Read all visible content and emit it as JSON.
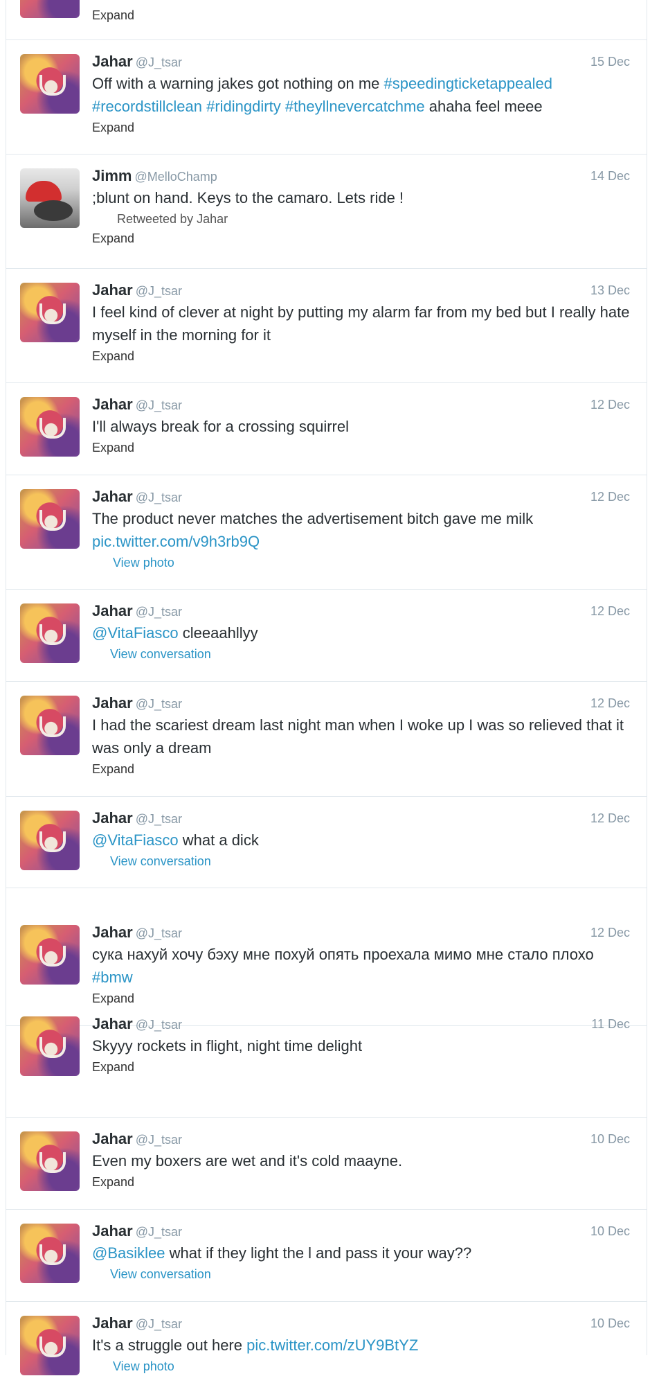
{
  "timeline": {
    "top_fragment": {
      "expand_label": "Expand"
    },
    "tweets": [
      {
        "name": "Jahar",
        "handle": "@J_tsar",
        "date": "15 Dec",
        "text_parts": [
          {
            "t": "Off with a warning jakes got nothing on me "
          },
          {
            "t": "#speedingticketappealed",
            "link": true
          },
          {
            "t": " "
          },
          {
            "t": "#recordstillclean",
            "link": true
          },
          {
            "t": " "
          },
          {
            "t": "#ridingdirty",
            "link": true
          },
          {
            "t": " "
          },
          {
            "t": "#theyllnevercatchme",
            "link": true
          },
          {
            "t": " ahaha feel meee"
          }
        ],
        "action": "Expand"
      },
      {
        "name": "Jimm",
        "handle": "@MelloChamp",
        "date": "14 Dec",
        "text_parts": [
          {
            "t": ";blunt on hand. Keys to the camaro. Lets ride !"
          }
        ],
        "retweeted_by": "Retweeted by Jahar",
        "action": "Expand"
      },
      {
        "name": "Jahar",
        "handle": "@J_tsar",
        "date": "13 Dec",
        "text_parts": [
          {
            "t": "I feel kind of clever at night by putting my alarm far from my bed but I really hate myself in the morning for it"
          }
        ],
        "action": "Expand"
      },
      {
        "name": "Jahar",
        "handle": "@J_tsar",
        "date": "12 Dec",
        "text_parts": [
          {
            "t": "I'll always break for a crossing squirrel"
          }
        ],
        "action": "Expand"
      },
      {
        "name": "Jahar",
        "handle": "@J_tsar",
        "date": "12 Dec",
        "text_parts": [
          {
            "t": "The product never matches the advertisement bitch gave me milk "
          },
          {
            "t": "pic.twitter.com/v9h3rb9Q",
            "link": true
          }
        ],
        "action": "View photo"
      },
      {
        "name": "Jahar",
        "handle": "@J_tsar",
        "date": "12 Dec",
        "text_parts": [
          {
            "t": "@VitaFiasco",
            "link": true
          },
          {
            "t": " cleeaahllyy"
          }
        ],
        "action": "View conversation"
      },
      {
        "name": "Jahar",
        "handle": "@J_tsar",
        "date": "12 Dec",
        "text_parts": [
          {
            "t": "I had the scariest dream last night man when I woke up I was so relieved that it was only a dream"
          }
        ],
        "action": "Expand"
      },
      {
        "name": "Jahar",
        "handle": "@J_tsar",
        "date": "12 Dec",
        "text_parts": [
          {
            "t": "@VitaFiasco",
            "link": true
          },
          {
            "t": " what a dick"
          }
        ],
        "action": "View conversation"
      },
      {
        "name": "Jahar",
        "handle": "@J_tsar",
        "date": "12 Dec",
        "text_parts": [
          {
            "t": "сука нахуй хочу бэху мне похуй опять проехала мимо мне стало плохо "
          },
          {
            "t": "#bmw",
            "link": true
          }
        ],
        "action": "Expand"
      },
      {
        "name": "Jahar",
        "handle": "@J_tsar",
        "date": "11 Dec",
        "text_parts": [
          {
            "t": "Skyyy rockets in flight, night time delight"
          }
        ],
        "action": "Expand"
      },
      {
        "name": "Jahar",
        "handle": "@J_tsar",
        "date": "10 Dec",
        "text_parts": [
          {
            "t": "Even my boxers are wet and it's cold maayne."
          }
        ],
        "action": "Expand"
      },
      {
        "name": "Jahar",
        "handle": "@J_tsar",
        "date": "10 Dec",
        "text_parts": [
          {
            "t": "@Basiklee",
            "link": true
          },
          {
            "t": " what if they light the l and pass it your way??"
          }
        ],
        "action": "View conversation"
      },
      {
        "name": "Jahar",
        "handle": "@J_tsar",
        "date": "10 Dec",
        "text_parts": [
          {
            "t": "It's a struggle out here "
          },
          {
            "t": "pic.twitter.com/zUY9BtYZ",
            "link": true
          }
        ],
        "action": "View photo"
      }
    ]
  },
  "colors": {
    "link": "#2a94c6",
    "divider": "#e1e8ed",
    "meta": "#8899a6"
  }
}
